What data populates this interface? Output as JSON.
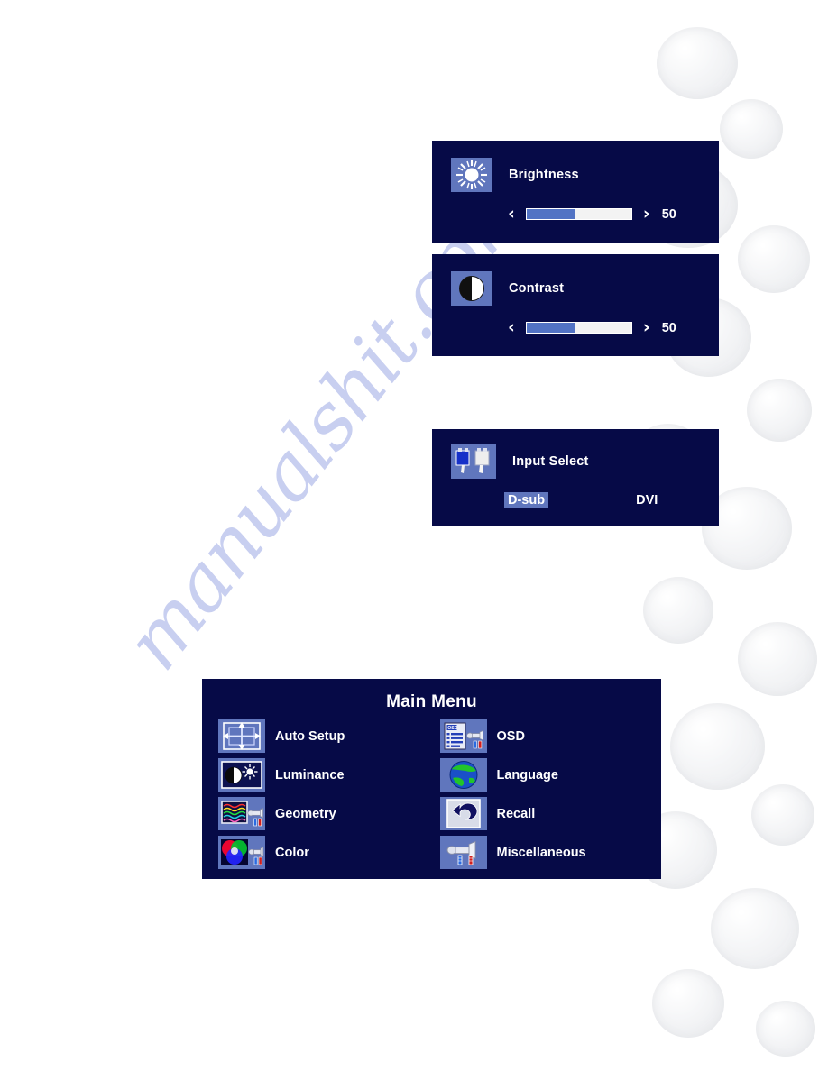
{
  "page": {
    "background_color": "#ffffff",
    "osd_background": "#060a47",
    "icon_tile_color": "#6076bd",
    "highlight_color": "#6076bd",
    "slider_fill_color": "#5273c4",
    "watermark_text": "manualshit.com"
  },
  "brightness_panel": {
    "icon": "sun-icon",
    "label": "Brightness",
    "left_arrow": "‹",
    "right_arrow": "›",
    "value": "50",
    "percent": 47
  },
  "contrast_panel": {
    "icon": "contrast-icon",
    "label": "Contrast",
    "left_arrow": "‹",
    "right_arrow": "›",
    "value": "50",
    "percent": 47
  },
  "input_select_panel": {
    "icon": "connectors-icon",
    "label": "Input Select",
    "options": [
      {
        "label": "D-sub",
        "selected": true
      },
      {
        "label": "DVI",
        "selected": false
      }
    ]
  },
  "main_menu": {
    "title": "Main Menu",
    "items": [
      {
        "label": "Auto Setup",
        "icon": "auto-setup-icon"
      },
      {
        "label": "OSD",
        "icon": "osd-icon"
      },
      {
        "label": "Luminance",
        "icon": "luminance-icon"
      },
      {
        "label": "Language",
        "icon": "language-globe-icon"
      },
      {
        "label": "Geometry",
        "icon": "geometry-icon"
      },
      {
        "label": "Recall",
        "icon": "recall-icon"
      },
      {
        "label": "Color",
        "icon": "color-wheel-icon"
      },
      {
        "label": "Miscellaneous",
        "icon": "miscellaneous-icon"
      }
    ]
  }
}
